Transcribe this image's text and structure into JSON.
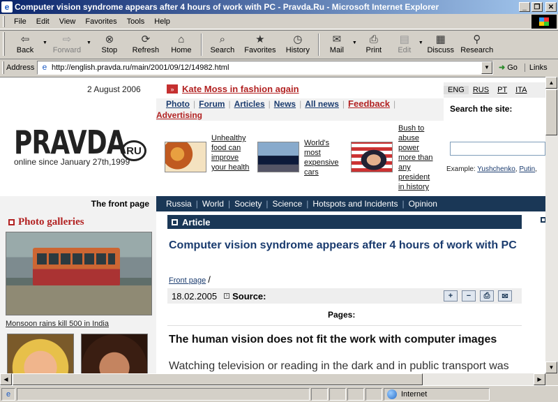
{
  "window": {
    "title": "Computer vision syndrome appears after 4 hours of work with PC - Pravda.Ru - Microsoft Internet Explorer"
  },
  "menu": [
    "File",
    "Edit",
    "View",
    "Favorites",
    "Tools",
    "Help"
  ],
  "toolbar": {
    "back": "Back",
    "forward": "Forward",
    "stop": "Stop",
    "refresh": "Refresh",
    "home": "Home",
    "search": "Search",
    "favorites": "Favorites",
    "history": "History",
    "mail": "Mail",
    "print": "Print",
    "edit": "Edit",
    "discuss": "Discuss",
    "research": "Research"
  },
  "address": {
    "label": "Address",
    "url": "http://english.pravda.ru/main/2001/09/12/14982.html",
    "go": "Go",
    "links": "Links"
  },
  "status": {
    "zone": "Internet"
  },
  "page": {
    "date": "2 August 2006",
    "logo": "PRAVDA",
    "logo_ru": "RU",
    "tagline": "online since January 27th,1999",
    "top_headline": "Kate Moss in fashion again",
    "languages": [
      "ENG",
      "RUS",
      "PT",
      "ITA"
    ],
    "nav": {
      "photo": "Photo",
      "forum": "Forum",
      "articles": "Articles",
      "news": "News",
      "allnews": "All news",
      "feedback": "Feedback",
      "advertising": "Advertising"
    },
    "search_label": "Search the site:",
    "example_label": "Example:",
    "example_links": [
      "Yushchenko",
      "Putin"
    ],
    "features": [
      "Unhealthy food can improve your health",
      "World's most expensive cars",
      "Bush to abuse power more than any president in history"
    ],
    "front_page": "The front page",
    "sections": [
      "Russia",
      "World",
      "Society",
      "Science",
      "Hotspots and Incidents",
      "Opinion"
    ],
    "photo_galleries": "Photo galleries",
    "photo_caption": "Monsoon rains kill 500 in India",
    "article_label": "Article",
    "article_title": "Computer vision syndrome appears after 4 hours of work with PC",
    "crumb": "Front page",
    "crumb_sep": "/",
    "article_date": "18.02.2005",
    "source_label": "Source:",
    "pages_label": "Pages:",
    "subhead": "The human vision does not fit the work with computer images",
    "body": "Watching television or reading in the dark and in public transport was"
  }
}
